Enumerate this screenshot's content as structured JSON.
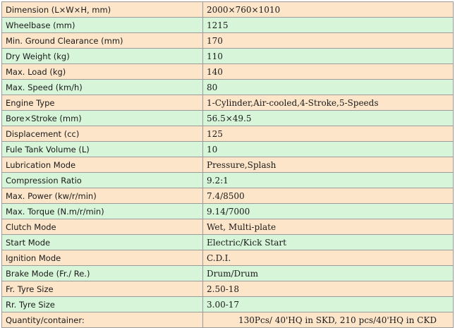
{
  "specs": [
    {
      "label": "Dimension (L×W×H, mm)",
      "value": "2000×760×1010",
      "shade": "peach"
    },
    {
      "label": "Wheelbase (mm)",
      "value": "1215",
      "shade": "green"
    },
    {
      "label": "Min. Ground Clearance (mm)",
      "value": "170",
      "shade": "peach"
    },
    {
      "label": "Dry Weight (kg)",
      "value": "110",
      "shade": "green"
    },
    {
      "label": "Max. Load (kg)",
      "value": "140",
      "shade": "peach"
    },
    {
      "label": "Max. Speed (km/h)",
      "value": "80",
      "shade": "green"
    },
    {
      "label": "Engine Type",
      "value": "1-Cylinder,Air-cooled,4-Stroke,5-Speeds",
      "shade": "peach"
    },
    {
      "label": "Bore×Stroke (mm)",
      "value": "56.5×49.5",
      "shade": "green"
    },
    {
      "label": "Displacement (cc)",
      "value": "125",
      "shade": "peach"
    },
    {
      "label": "Fule Tank Volume (L)",
      "value": "10",
      "shade": "green"
    },
    {
      "label": "Lubrication Mode",
      "value": "Pressure,Splash",
      "shade": "peach"
    },
    {
      "label": "Compression Ratio",
      "value": "9.2:1",
      "shade": "green"
    },
    {
      "label": "Max. Power (kw/r/min)",
      "value": "7.4/8500",
      "shade": "peach"
    },
    {
      "label": "Max. Torque (N.m/r/min)",
      "value": "9.14/7000",
      "shade": "green"
    },
    {
      "label": "Clutch Mode",
      "value": "Wet, Multi-plate",
      "shade": "peach"
    },
    {
      "label": "Start Mode",
      "value": "Electric/Kick Start",
      "shade": "green"
    },
    {
      "label": "Ignition Mode",
      "value": "C.D.I.",
      "shade": "peach"
    },
    {
      "label": "Brake Mode (Fr./ Re.)",
      "value": "Drum/Drum",
      "shade": "green"
    },
    {
      "label": "Fr. Tyre Size",
      "value": "2.50-18",
      "shade": "peach"
    },
    {
      "label": "Rr. Tyre Size",
      "value": "3.00-17",
      "shade": "green"
    }
  ],
  "quantity": {
    "label": "Quantity/container:",
    "value": "130Pcs/ 40'HQ in SKD,  210 pcs/40'HQ in CKD",
    "shade": "peach"
  },
  "colors": {
    "peach": "#fde5c9",
    "green": "#d6f5d9",
    "border": "#9a9a9a"
  }
}
